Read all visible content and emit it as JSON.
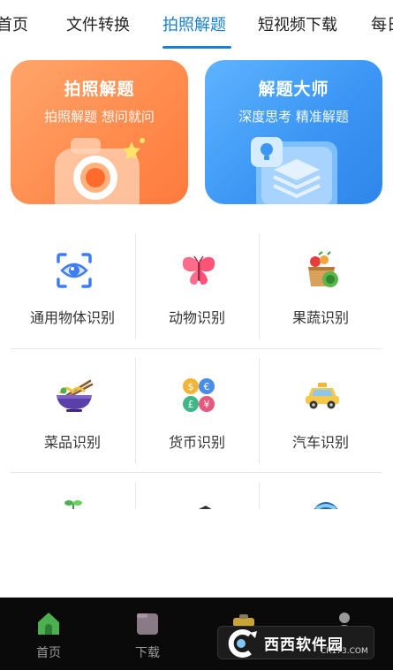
{
  "tabs": [
    {
      "label": "首页",
      "active": false
    },
    {
      "label": "文件转换",
      "active": false
    },
    {
      "label": "拍照解题",
      "active": true
    },
    {
      "label": "短视频下载",
      "active": false
    },
    {
      "label": "每日",
      "active": false
    }
  ],
  "banners": [
    {
      "title": "拍照解题",
      "subtitle": "拍照解题  想问就问",
      "icon": "camera-icon"
    },
    {
      "title": "解题大师",
      "subtitle": "深度思考  精准解题",
      "icon": "lightbulb-layers-icon"
    }
  ],
  "grid": [
    {
      "label": "通用物体识别",
      "icon": "eye-scan-icon"
    },
    {
      "label": "动物识别",
      "icon": "butterfly-icon"
    },
    {
      "label": "果蔬识别",
      "icon": "fruit-basket-icon"
    },
    {
      "label": "菜品识别",
      "icon": "noodle-bowl-icon"
    },
    {
      "label": "货币识别",
      "icon": "currency-coins-icon"
    },
    {
      "label": "汽车识别",
      "icon": "taxi-icon"
    }
  ],
  "bottom_nav": [
    {
      "label": "首页",
      "icon": "home-icon",
      "active": true
    },
    {
      "label": "下载",
      "icon": "download-folder-icon",
      "active": false
    }
  ],
  "watermark": {
    "text": "西西软件园",
    "sub": "CR173.COM"
  },
  "colors": {
    "accent": "#1a7fd1",
    "orange_card": "#ff8a4c",
    "blue_card": "#3c96f4",
    "nav_bg": "#0a0a0a"
  }
}
